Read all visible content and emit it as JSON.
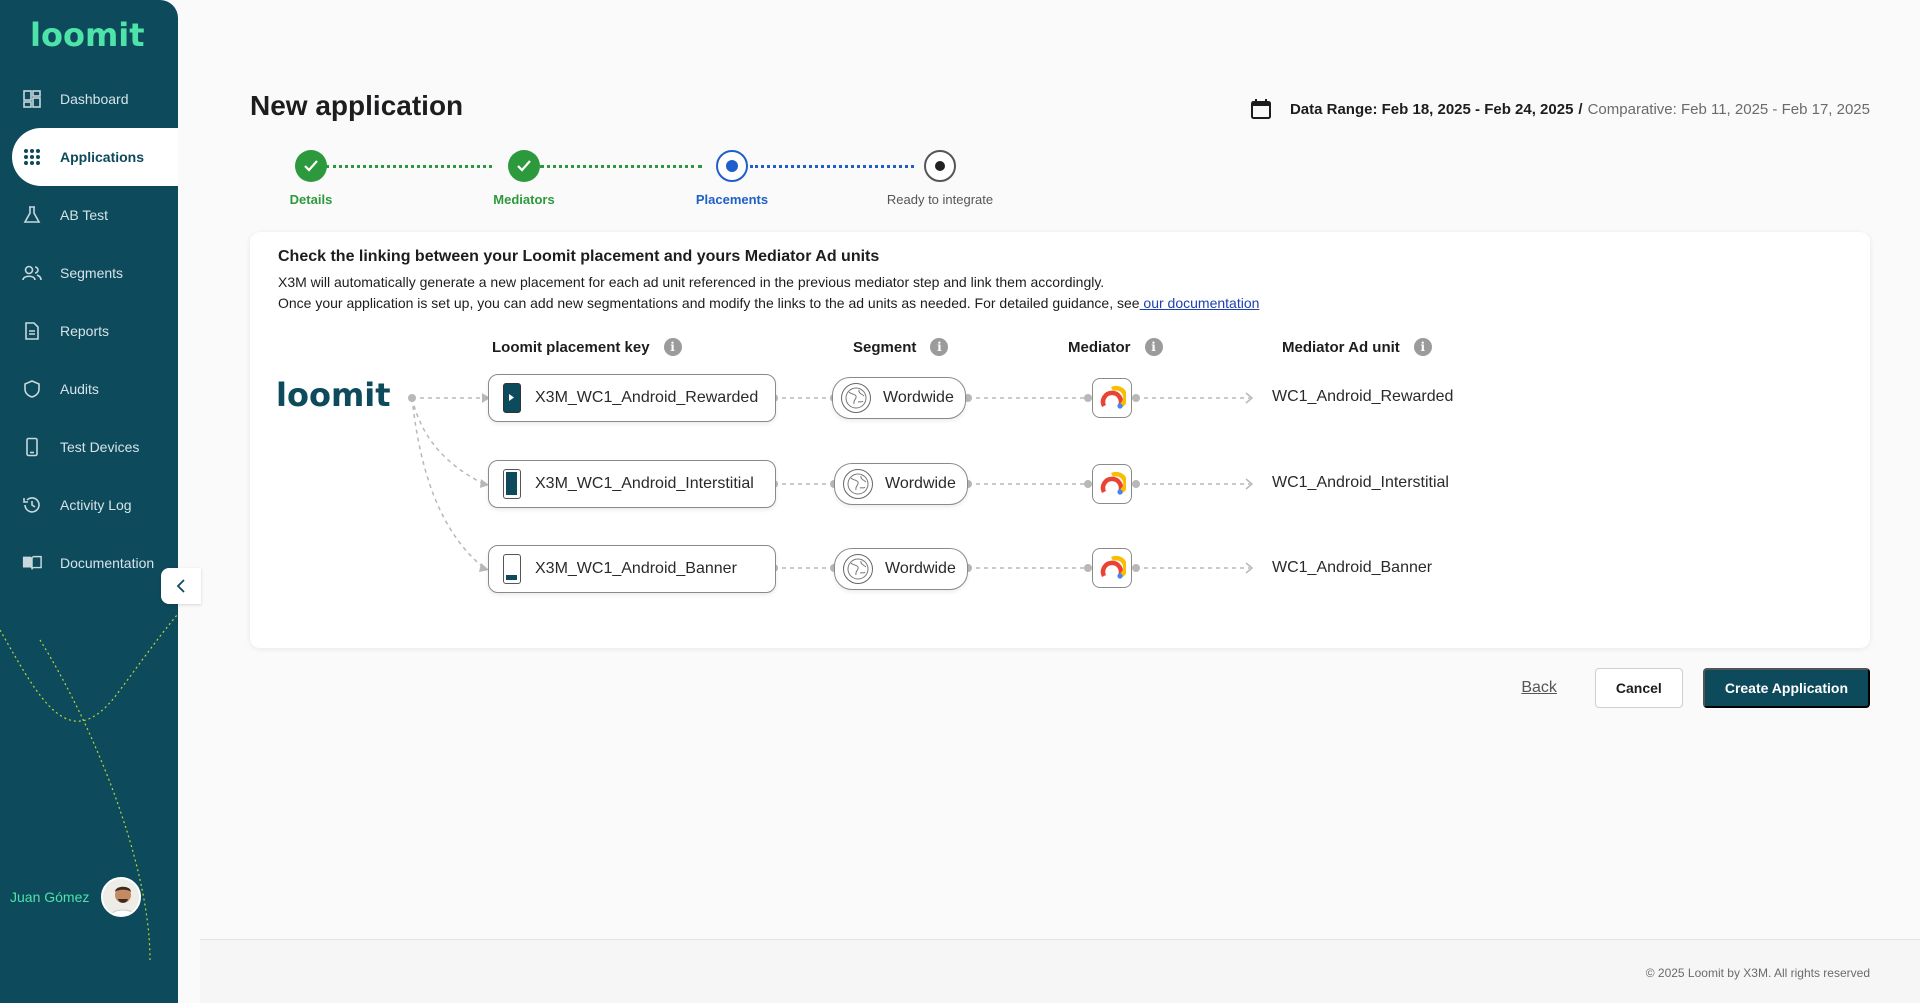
{
  "app": {
    "logo_text": "loomit"
  },
  "sidebar": {
    "items": [
      {
        "label": "Dashboard",
        "icon": "dashboard-icon"
      },
      {
        "label": "Applications",
        "icon": "grid-icon",
        "active": true
      },
      {
        "label": "AB Test",
        "icon": "flask-icon"
      },
      {
        "label": "Segments",
        "icon": "users-icon"
      },
      {
        "label": "Reports",
        "icon": "document-icon"
      },
      {
        "label": "Audits",
        "icon": "shield-icon"
      },
      {
        "label": "Test Devices",
        "icon": "phone-icon"
      },
      {
        "label": "Activity Log",
        "icon": "history-icon"
      },
      {
        "label": "Documentation",
        "icon": "book-icon"
      }
    ],
    "user_name": "Juan Gómez"
  },
  "header": {
    "title": "New application",
    "date_range_label": "Data Range: Feb 18, 2025 - Feb 24, 2025",
    "date_range_sep": "/",
    "comparative_label": "Comparative: Feb 11, 2025 - Feb 17, 2025"
  },
  "stepper": {
    "steps": [
      {
        "label": "Details",
        "state": "done"
      },
      {
        "label": "Mediators",
        "state": "done"
      },
      {
        "label": "Placements",
        "state": "current"
      },
      {
        "label": "Ready to integrate",
        "state": "todo"
      }
    ]
  },
  "card": {
    "heading": "Check the linking between your Loomit placement and yours Mediator Ad units",
    "desc_line1": "X3M will automatically generate a new placement for each ad unit referenced in the previous mediator step and link them accordingly.",
    "desc_line2": "Once your application is set up, you can add new segmentations and modify the links to the ad units as needed. For detailed guidance, see",
    "desc_link": " our documentation",
    "columns": {
      "placement": "Loomit placement key",
      "segment": "Segment",
      "mediator": "Mediator",
      "ad_unit": "Mediator Ad unit"
    },
    "rows": [
      {
        "placement": "X3M_WC1_Android_Rewarded",
        "segment": "Wordwide",
        "ad_unit": "WC1_Android_Rewarded"
      },
      {
        "placement": "X3M_WC1_Android_Interstitial",
        "segment": "Wordwide",
        "ad_unit": "WC1_Android_Interstitial"
      },
      {
        "placement": "X3M_WC1_Android_Banner",
        "segment": "Wordwide",
        "ad_unit": "WC1_Android_Banner"
      }
    ]
  },
  "actions": {
    "back": "Back",
    "cancel": "Cancel",
    "create": "Create Application"
  },
  "footer": {
    "copyright": "© 2025 Loomit by X3M. All rights reserved"
  },
  "colors": {
    "sidebar_bg": "#0d4a5c",
    "brand_green": "#4ee3a8",
    "step_done": "#2c9a3c",
    "step_current": "#1e5fc9",
    "primary_button": "#0d4a5c"
  }
}
